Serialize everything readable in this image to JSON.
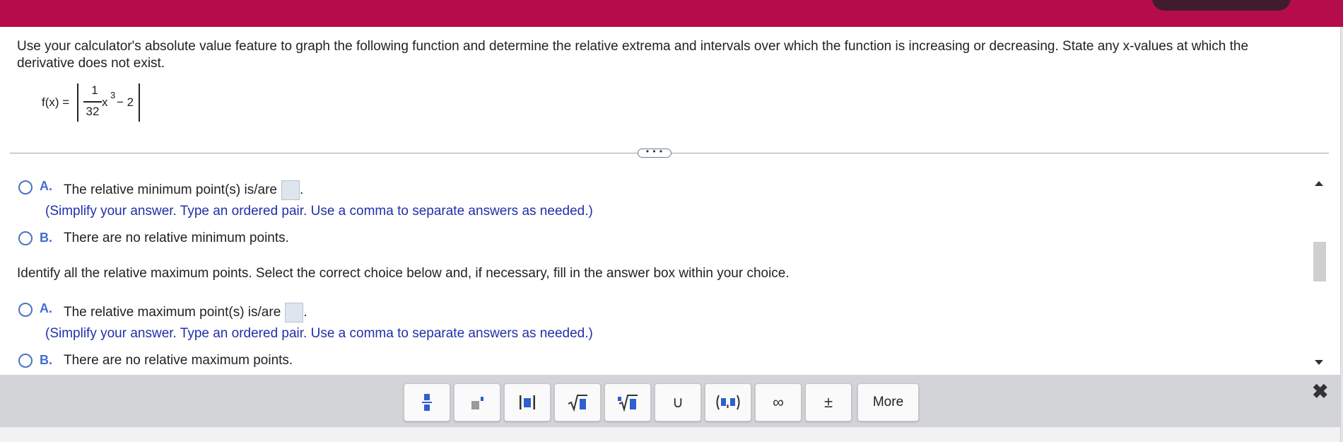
{
  "question": {
    "text": "Use your calculator's absolute value feature to graph the following function and determine the relative extrema and intervals over which the function is increasing or decreasing. State any x-values at which the derivative does not exist."
  },
  "formula": {
    "lhs": "f(x) =",
    "numerator": "1",
    "denominator": "32",
    "x": "x",
    "exponent": "3",
    "rest": "− 2"
  },
  "expander": {
    "label": "• • •"
  },
  "minimum": {
    "choice_a": {
      "letter": "A.",
      "text": "The relative minimum point(s) is/are",
      "hint": "(Simplify your answer. Type an ordered pair. Use a comma to separate answers as needed.)"
    },
    "choice_b": {
      "letter": "B.",
      "text": "There are no relative minimum points."
    }
  },
  "identify": {
    "text": "Identify all the relative maximum points. Select the correct choice below and, if necessary, fill in the answer box within your choice."
  },
  "maximum": {
    "choice_a": {
      "letter": "A.",
      "text": "The relative maximum point(s) is/are",
      "hint": "(Simplify your answer. Type an ordered pair. Use a comma to separate answers as needed.)"
    },
    "choice_b": {
      "letter": "B.",
      "text": "There are no relative maximum points."
    }
  },
  "toolbar": {
    "buttons": [
      {
        "icon": "fraction-icon"
      },
      {
        "icon": "superscript-icon"
      },
      {
        "icon": "absolute-value-icon"
      },
      {
        "icon": "square-root-icon"
      },
      {
        "icon": "nth-root-icon"
      },
      {
        "icon": "union-icon",
        "glyph": "∪"
      },
      {
        "icon": "ordered-pair-icon"
      },
      {
        "icon": "infinity-icon",
        "glyph": "∞"
      },
      {
        "icon": "plus-minus-icon",
        "glyph": "±"
      }
    ],
    "more_label": "More",
    "close_glyph": "✖"
  },
  "colors": {
    "header": "#b50c4c",
    "accent": "#3f6ed1",
    "hint": "#2130a8",
    "icon_blue": "#2f5fd0"
  }
}
